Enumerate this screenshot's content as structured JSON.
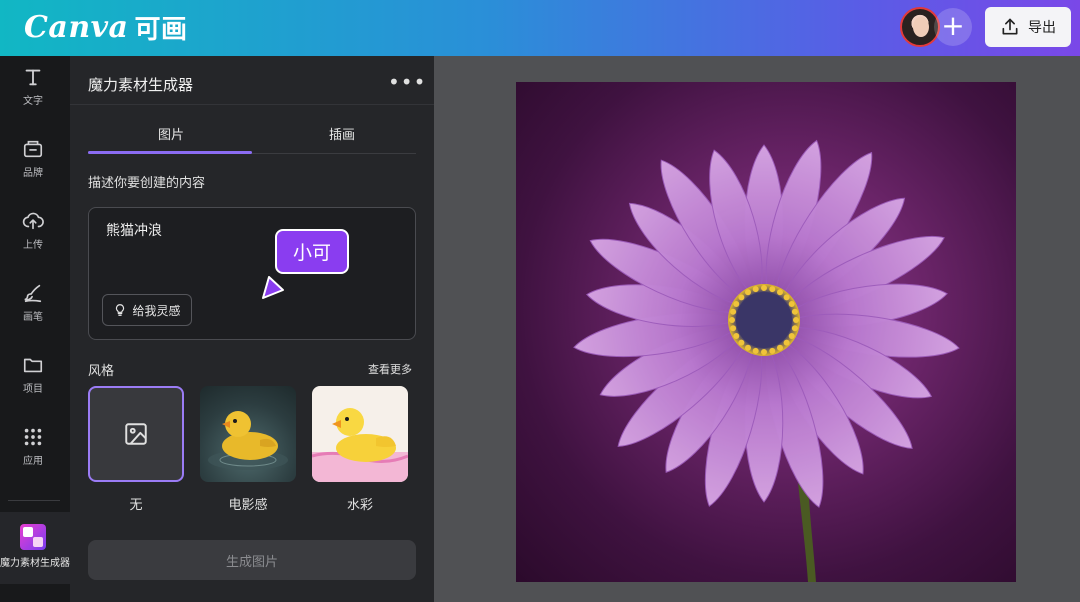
{
  "header": {
    "logo_text": "Canva",
    "logo_cn": "可画",
    "export_label": "导出"
  },
  "rail": {
    "items": [
      {
        "label": "文字",
        "icon": "text-icon"
      },
      {
        "label": "品牌",
        "icon": "brand-icon"
      },
      {
        "label": "上传",
        "icon": "upload-icon"
      },
      {
        "label": "画笔",
        "icon": "brush-icon"
      },
      {
        "label": "项目",
        "icon": "folder-icon"
      },
      {
        "label": "应用",
        "icon": "apps-icon"
      }
    ],
    "active_label": "魔力素材生成器"
  },
  "panel": {
    "title": "魔力素材生成器",
    "tabs": [
      {
        "label": "图片"
      },
      {
        "label": "插画"
      }
    ],
    "describe_label": "描述你要创建的内容",
    "prompt_value": "熊猫冲浪",
    "inspire_label": "给我灵感",
    "bubble_text": "小可",
    "style_label": "风格",
    "see_more_label": "查看更多",
    "styles": [
      {
        "label": "无"
      },
      {
        "label": "电影感"
      },
      {
        "label": "水彩"
      }
    ],
    "generate_label": "生成图片"
  },
  "colors": {
    "accent": "#8b6cf3",
    "bubble": "#8a3df0",
    "header_start": "#11b7c4",
    "header_end": "#7a48e8"
  }
}
